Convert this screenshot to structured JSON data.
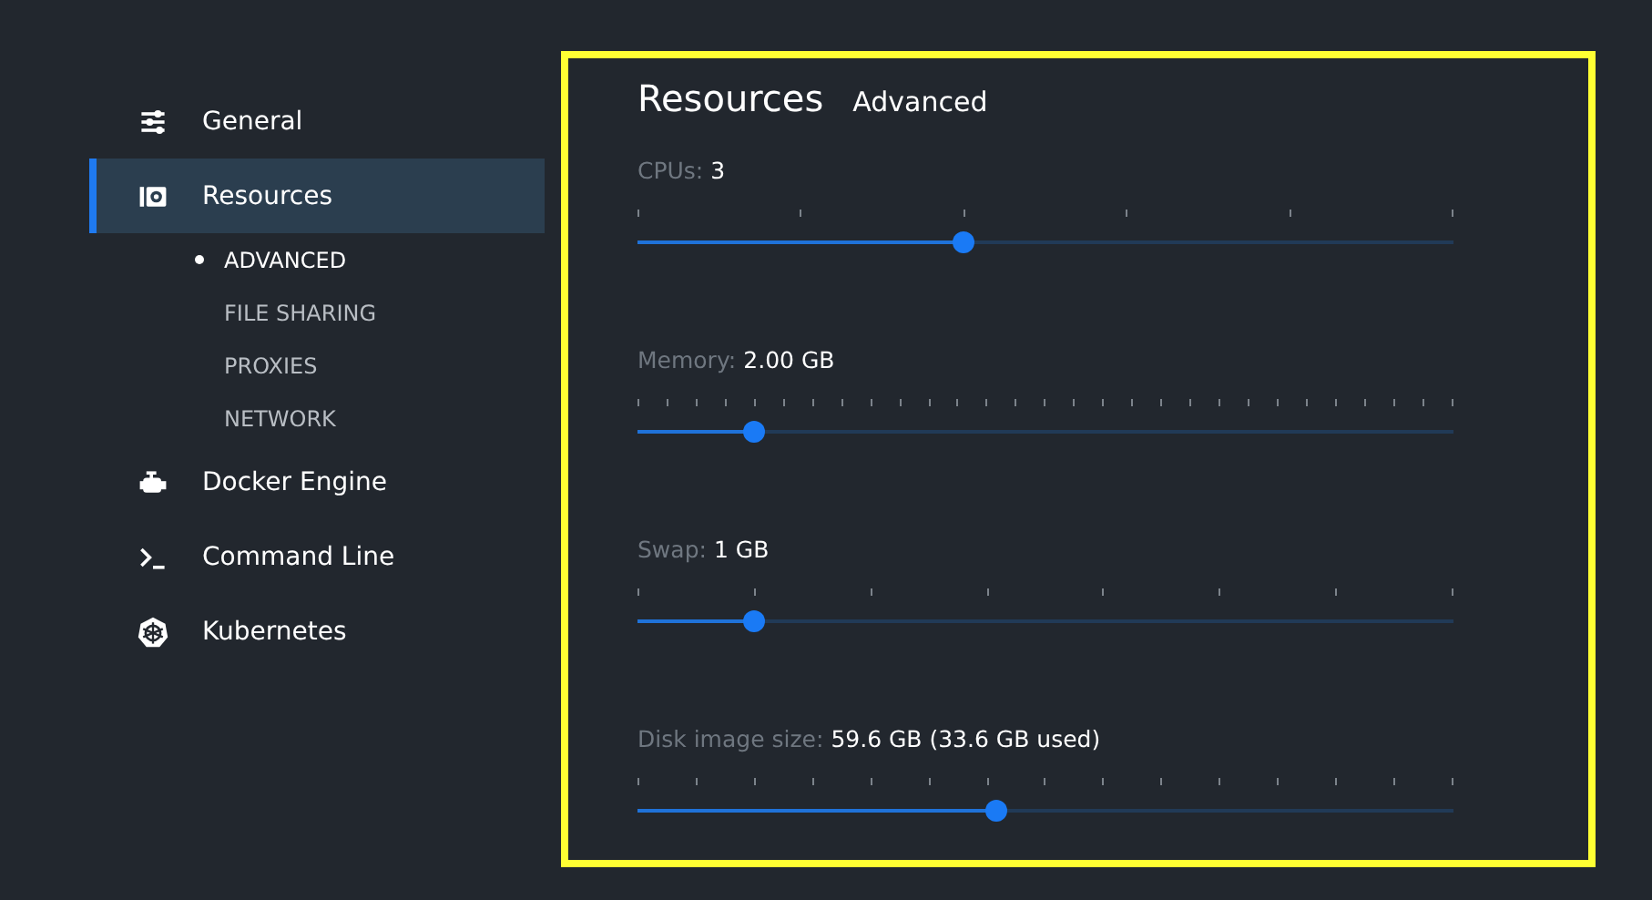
{
  "sidebar": {
    "items": [
      {
        "label": "General",
        "selected": false
      },
      {
        "label": "Resources",
        "selected": true,
        "children": [
          {
            "label": "ADVANCED",
            "selected": true
          },
          {
            "label": "FILE SHARING",
            "selected": false
          },
          {
            "label": "PROXIES",
            "selected": false
          },
          {
            "label": "NETWORK",
            "selected": false
          }
        ]
      },
      {
        "label": "Docker Engine",
        "selected": false
      },
      {
        "label": "Command Line",
        "selected": false
      },
      {
        "label": "Kubernetes",
        "selected": false
      }
    ]
  },
  "panel": {
    "title": "Resources",
    "subtitle": "Advanced",
    "sliders": [
      {
        "label": "CPUs:",
        "value": "3",
        "level": 0.4
      },
      {
        "label": "Memory:",
        "value": "2.00 GB",
        "level": 0.143
      },
      {
        "label": "Swap:",
        "value": "1 GB",
        "level": 0.143
      },
      {
        "label": "Disk image size:",
        "value": "59.6 GB (33.6 GB used)",
        "level": 0.44
      }
    ]
  }
}
